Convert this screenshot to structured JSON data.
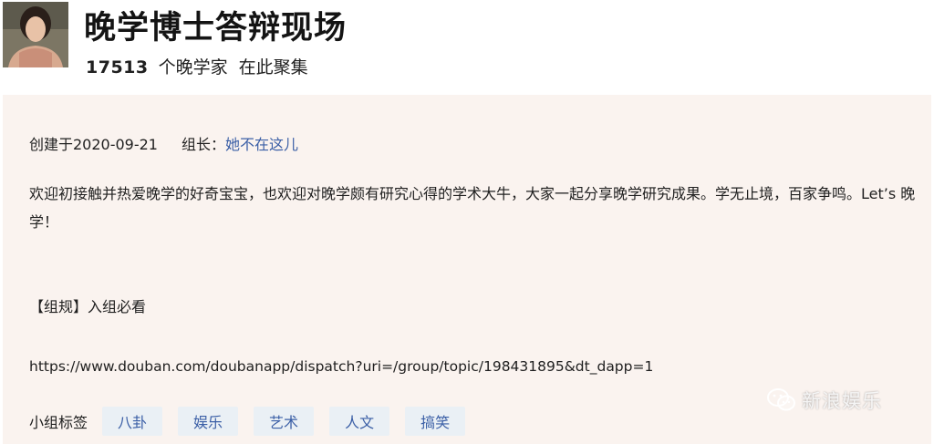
{
  "header": {
    "title": "晚学博士答辩现场",
    "member_count": "17513",
    "member_suffix_1": "个晚学家",
    "member_suffix_2": "在此聚集"
  },
  "meta": {
    "created_label": "创建于2020-09-21",
    "leader_label": "组长：",
    "leader_name": "她不在这儿"
  },
  "intro": "欢迎初接触并热爱晚学的好奇宝宝，也欢迎对晚学颇有研究心得的学术大牛，大家一起分享晚学研究成果。学无止境，百家争鸣。Let’s 晚学！",
  "rules_title": "【组规】入组必看",
  "rules_url": "https://www.douban.com/doubanapp/dispatch?uri=/group/topic/198431895&dt_dapp=1",
  "tags": {
    "label": "小组标签",
    "items": [
      "八卦",
      "娱乐",
      "艺术",
      "人文",
      "搞笑"
    ]
  },
  "watermark": {
    "text": "新浪娱乐",
    "icon": "wechat-icon"
  },
  "colors": {
    "panel_bg": "#faf3ef",
    "link": "#3b5fa6",
    "tag_bg": "#eaf0f5"
  }
}
